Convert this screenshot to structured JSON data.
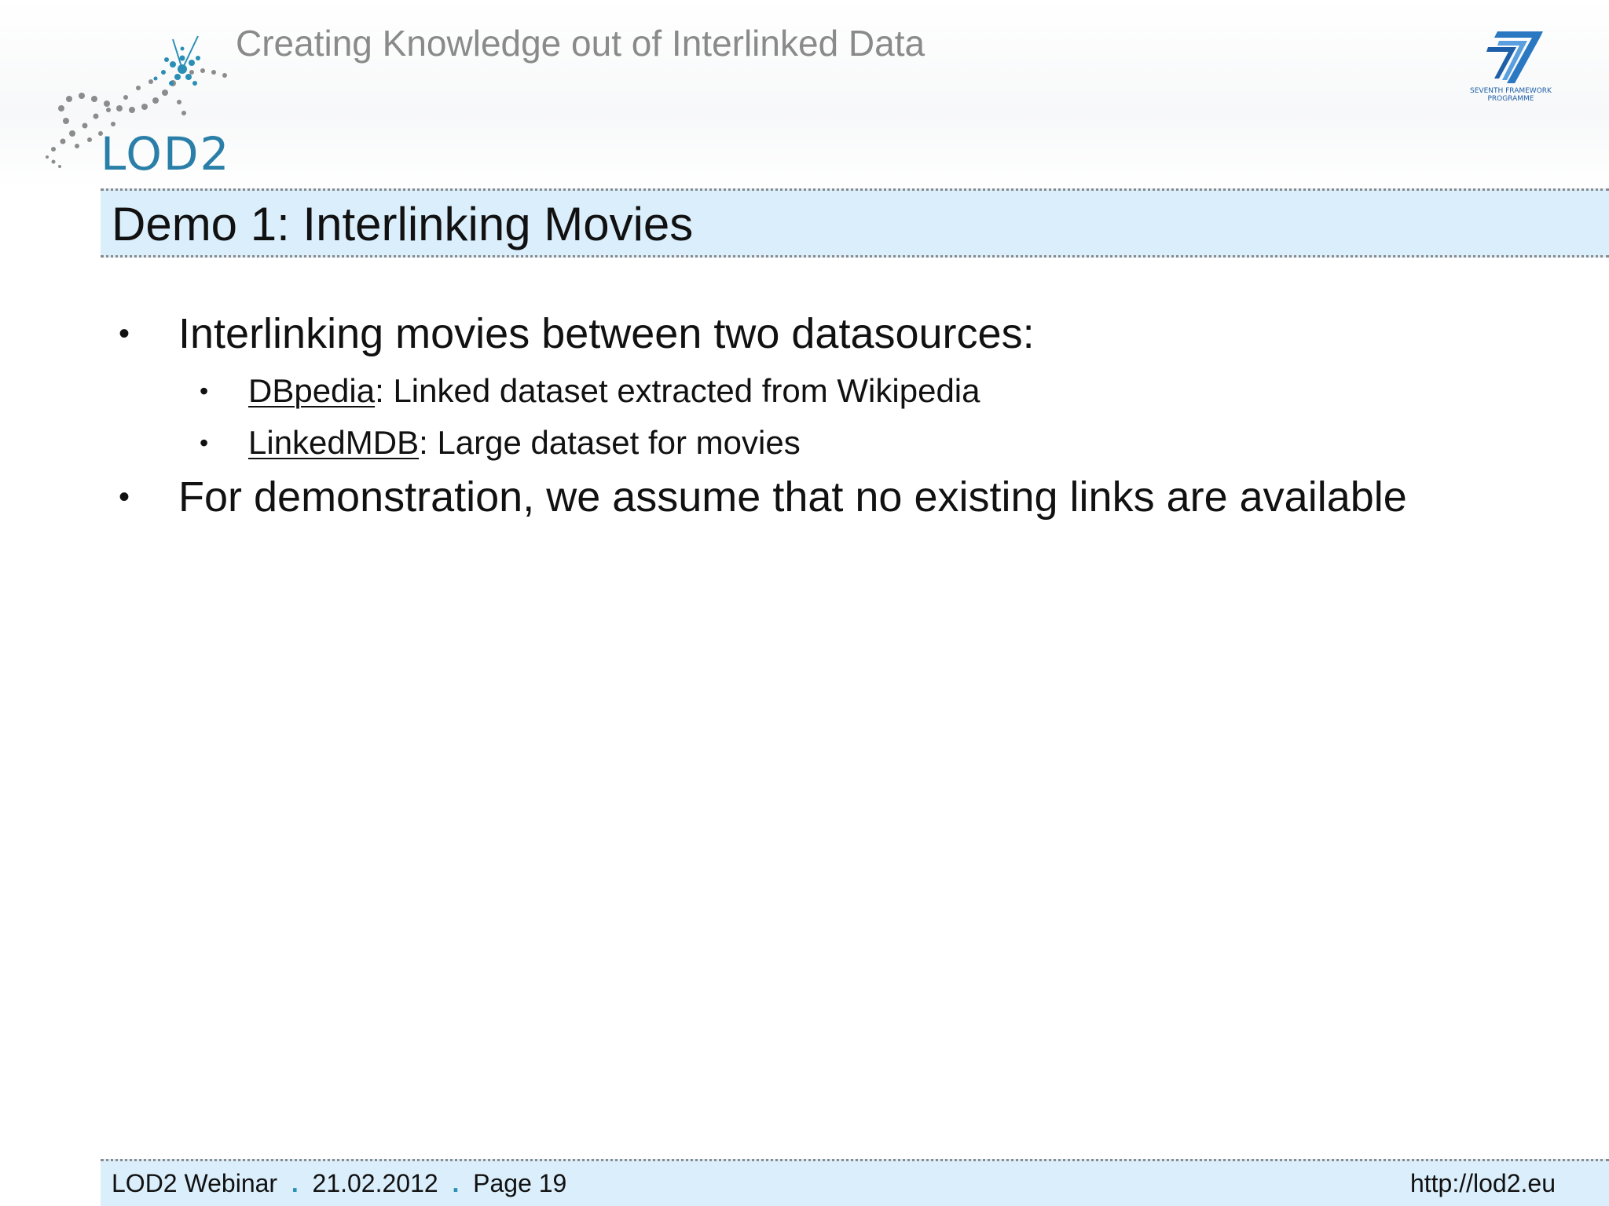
{
  "header": {
    "tagline": "Creating Knowledge out of Interlinked Data",
    "logo_text": "LOD2",
    "fp7_logo_text": [
      "SEVENTH FRAMEWORK",
      "PROGRAMME"
    ]
  },
  "slide": {
    "title": "Demo 1: Interlinking Movies",
    "bullets": [
      {
        "text": "Interlinking movies between two datasources:",
        "sub": [
          {
            "link": "DBpedia",
            "text": ": Linked dataset extracted from Wikipedia"
          },
          {
            "link": "LinkedMDB",
            "text": ": Large dataset for movies"
          }
        ]
      },
      {
        "text": "For demonstration, we assume that no existing links are available"
      }
    ]
  },
  "footer": {
    "event": "LOD2 Webinar",
    "separator": ".",
    "date": "21.02.2012",
    "page": "Page 19",
    "url": "http://lod2.eu"
  },
  "colors": {
    "accent_blue": "#2a8fb5",
    "title_bar_bg": "#dbeefb",
    "tagline_gray": "#8a8a8a"
  }
}
